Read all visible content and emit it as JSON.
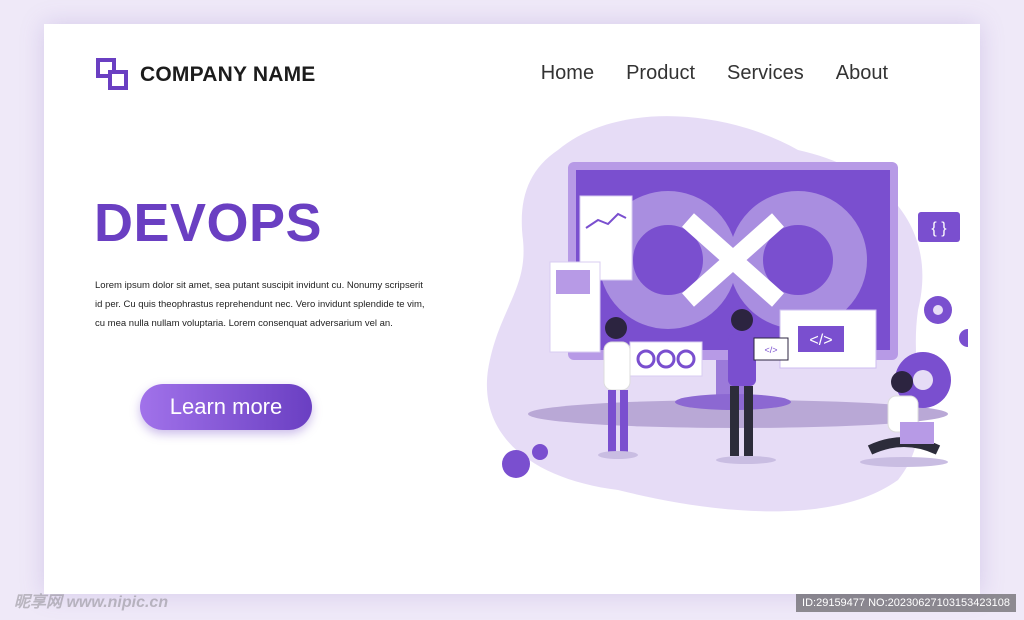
{
  "brand": {
    "name": "COMPANY NAME"
  },
  "nav": {
    "items": [
      "Home",
      "Product",
      "Services",
      "About"
    ]
  },
  "hero": {
    "title": "DEVOPS",
    "body": "Lorem ipsum dolor sit amet, sea putant suscipit invidunt cu. Nonumy scripserit id per. Cu quis theophrastus reprehendunt nec. Vero invidunt splendide te vim, cu mea nulla nullam voluptaria. Lorem consenquat adversarium vel an.",
    "cta": "Learn more"
  },
  "illustration": {
    "code_badge": "{ }",
    "code_tag": "</>",
    "laptop_tag": "</>"
  },
  "watermark": {
    "site": "昵享网 www.nipic.cn",
    "id": "ID:29159477 NO:20230627103153423108"
  },
  "colors": {
    "accent": "#6a3fc2",
    "accent_light": "#a172ea",
    "blob": "#e6dcf6"
  }
}
